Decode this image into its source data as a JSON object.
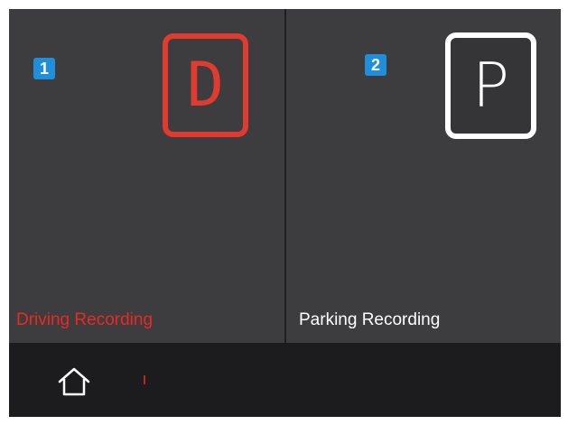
{
  "panels": [
    {
      "badge": "1",
      "mode_letter": "D",
      "label": "Driving Recording",
      "accent_color": "#e03b2f",
      "active": true
    },
    {
      "badge": "2",
      "mode_letter": "P",
      "label": "Parking Recording",
      "accent_color": "#ffffff",
      "active": false
    }
  ],
  "bottom_bar": {
    "home_icon": "home-icon",
    "indicator_color": "#c0261e"
  },
  "colors": {
    "badge_bg": "#1e8fd8",
    "panel_bg": "#3d3d3f",
    "bar_bg": "#1c1c1e"
  }
}
